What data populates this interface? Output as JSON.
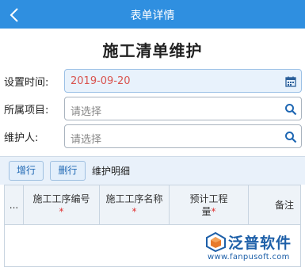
{
  "header": {
    "title": "表单详情",
    "back_icon": "chevron-left-icon"
  },
  "page": {
    "title": "施工清单维护"
  },
  "form": {
    "time_label": "设置时间:",
    "time_value": "2019-09-20",
    "project_label": "所属项目:",
    "project_placeholder": "请选择",
    "maintainer_label": "维护人:",
    "maintainer_placeholder": "请选择"
  },
  "toolbar": {
    "add_row": "增行",
    "delete_row": "删行",
    "section_title": "维护明细"
  },
  "grid": {
    "columns": [
      {
        "label": "...",
        "required": false
      },
      {
        "label": "施工工序编号",
        "required": true
      },
      {
        "label": "施工工序名称",
        "required": true
      },
      {
        "label": "预计工程量",
        "required": true
      },
      {
        "label": "备注",
        "required": false
      }
    ]
  },
  "watermark": {
    "brand": "泛普软件",
    "url": "www.fanpusoft.com"
  },
  "colors": {
    "header_bg": "#2f8fe0",
    "accent": "#1e67b3",
    "value_text": "#d9534f",
    "required": "#e03030"
  }
}
